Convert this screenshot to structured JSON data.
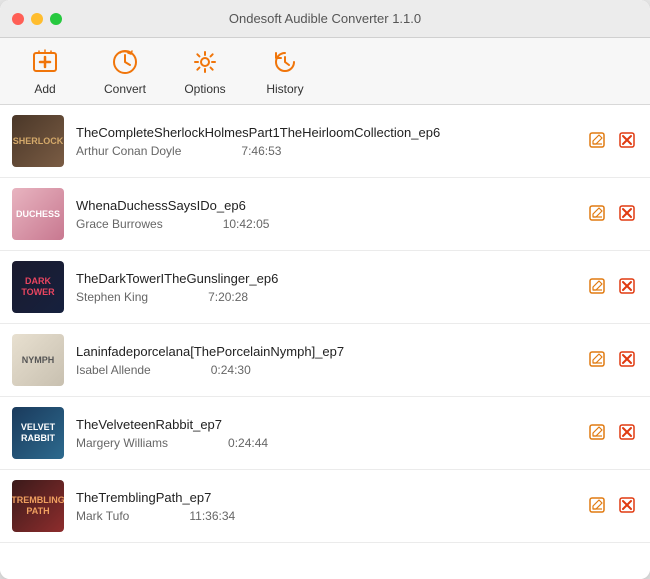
{
  "window": {
    "title": "Ondesoft Audible Converter 1.1.0"
  },
  "toolbar": {
    "items": [
      {
        "id": "add",
        "label": "Add",
        "icon": "➕",
        "icon_type": "add"
      },
      {
        "id": "convert",
        "label": "Convert",
        "icon": "🔄",
        "icon_type": "convert"
      },
      {
        "id": "options",
        "label": "Options",
        "icon": "⚙️",
        "icon_type": "options"
      },
      {
        "id": "history",
        "label": "History",
        "icon": "🕐",
        "icon_type": "history"
      }
    ]
  },
  "books": [
    {
      "id": 1,
      "title": "TheCompleteSherlockHolmesPart1TheHeirloomCollection_ep6",
      "author": "Arthur Conan Doyle",
      "duration": "7:46:53",
      "cover_class": "book-cover-1",
      "cover_label": "SHERLOCK"
    },
    {
      "id": 2,
      "title": "WhenaDuchessSaysIDo_ep6",
      "author": "Grace Burrowes",
      "duration": "10:42:05",
      "cover_class": "book-cover-2",
      "cover_label": "DUCHESS"
    },
    {
      "id": 3,
      "title": "TheDarkTowerITheGunslinger_ep6",
      "author": "Stephen King",
      "duration": "7:20:28",
      "cover_class": "book-cover-3",
      "cover_label": "DARK TOWER"
    },
    {
      "id": 4,
      "title": "Laninfadeporcelana[ThePorcelainNymph]_ep7",
      "author": "Isabel Allende",
      "duration": "0:24:30",
      "cover_class": "book-cover-4",
      "cover_label": "NYMPH"
    },
    {
      "id": 5,
      "title": "TheVelveteenRabbit_ep7",
      "author": "Margery Williams",
      "duration": "0:24:44",
      "cover_class": "book-cover-5",
      "cover_label": "VELVET RABBIT"
    },
    {
      "id": 6,
      "title": "TheTremblingPath_ep7",
      "author": "Mark Tufo",
      "duration": "11:36:34",
      "cover_class": "book-cover-6",
      "cover_label": "TREMBLING PATH"
    }
  ],
  "actions": {
    "edit_label": "✎",
    "delete_label": "✕"
  }
}
